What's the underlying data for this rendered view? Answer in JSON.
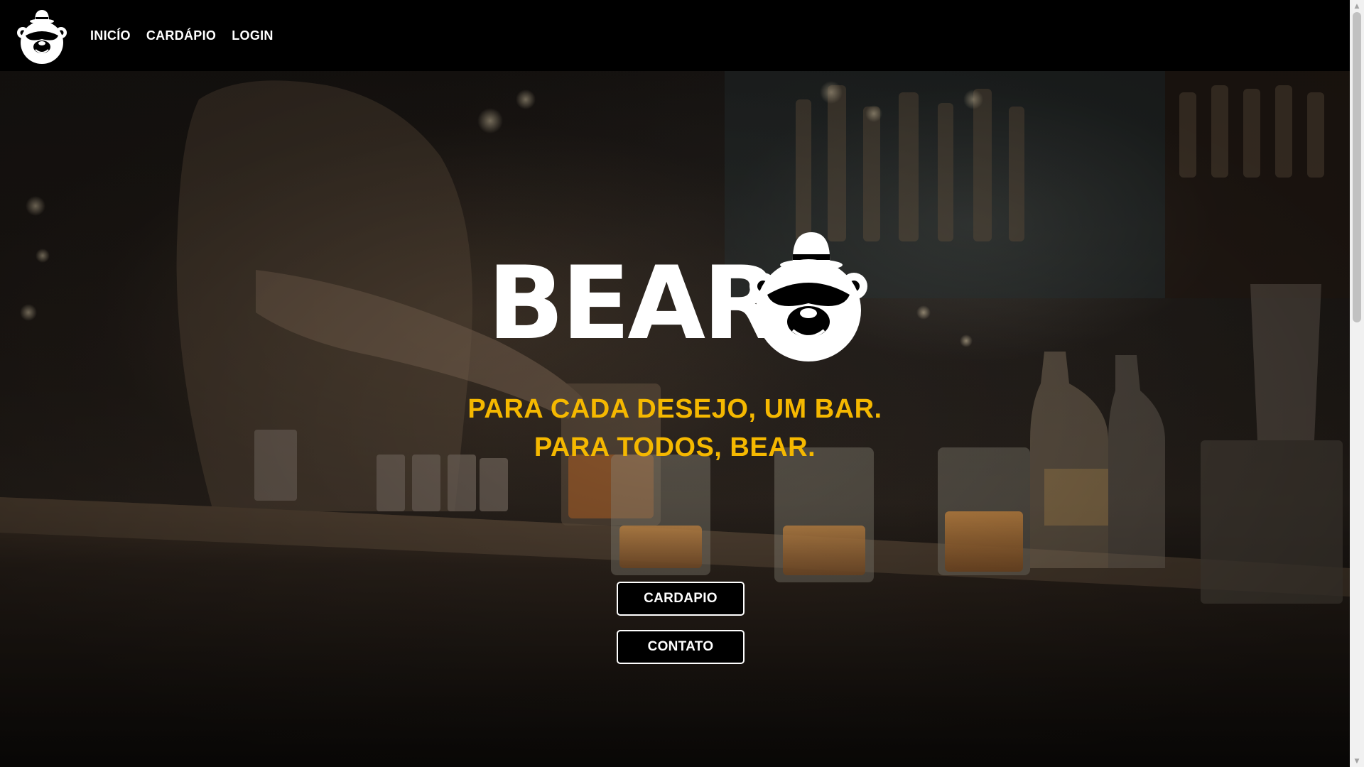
{
  "nav": {
    "logo_icon": "bear-with-bowler-hat-logo",
    "links": [
      {
        "label": "INICÍO"
      },
      {
        "label": "CARDÁPIO"
      },
      {
        "label": "LOGIN"
      }
    ]
  },
  "hero": {
    "background": "dark bar counter with bartender, bottles and glasses",
    "brand_text": "BEAR",
    "brand_icon": "bear-with-bowler-hat-logo",
    "tagline_line1": "PARA CADA DESEJO, UM BAR.",
    "tagline_line2": "PARA TODOS, BEAR.",
    "buttons": [
      {
        "label": "CARDAPIO"
      },
      {
        "label": "CONTATO"
      }
    ]
  },
  "colors": {
    "header_bg": "#000000",
    "nav_text": "#ffffff",
    "tagline": "#f5b800",
    "button_bg": "#000000",
    "button_border": "#ffffff"
  },
  "scrollbar": {
    "up_icon": "triangle-up-icon",
    "down_icon": "triangle-down-icon"
  }
}
